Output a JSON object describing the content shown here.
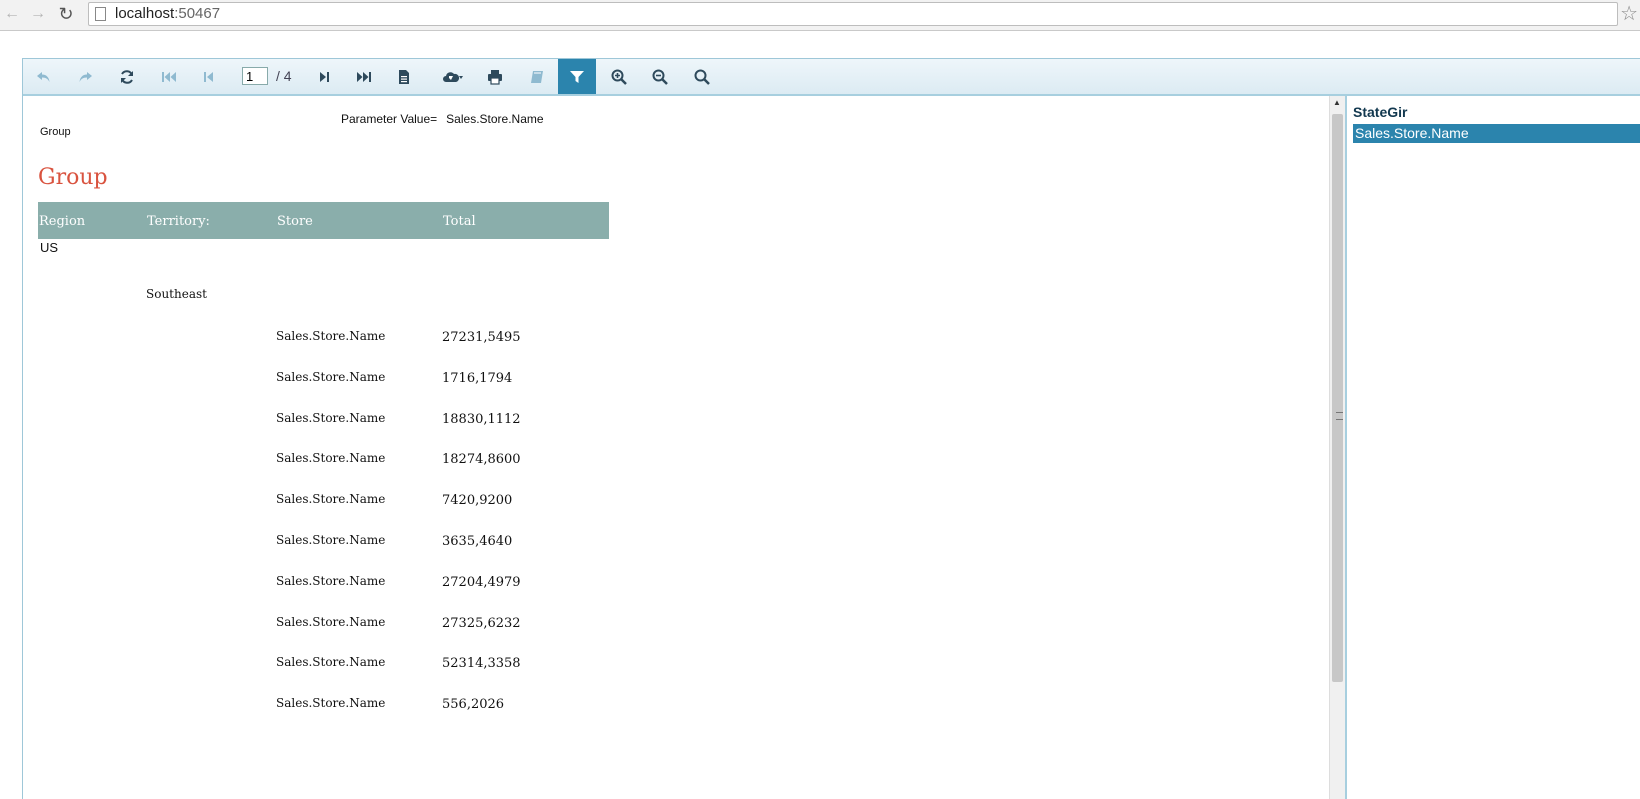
{
  "browser": {
    "url_host": "localhost",
    "url_port": ":50467"
  },
  "toolbar": {
    "current_page": "1",
    "total_pages": "/ 4"
  },
  "report": {
    "parameter_label": "Parameter Value=",
    "parameter_value": "Sales.Store.Name",
    "group_small_label": "Group",
    "group_title": "Group",
    "columns": [
      "Region",
      "Territory:",
      "Store",
      "Total"
    ],
    "region": "US",
    "territory": "Southeast",
    "rows": [
      {
        "store": "Sales.Store.Name",
        "total": "27231,5495"
      },
      {
        "store": "Sales.Store.Name",
        "total": "1716,1794"
      },
      {
        "store": "Sales.Store.Name",
        "total": "18830,1112"
      },
      {
        "store": "Sales.Store.Name",
        "total": "18274,8600"
      },
      {
        "store": "Sales.Store.Name",
        "total": "7420,9200"
      },
      {
        "store": "Sales.Store.Name",
        "total": "3635,4640"
      },
      {
        "store": "Sales.Store.Name",
        "total": "27204,4979"
      },
      {
        "store": "Sales.Store.Name",
        "total": "27325,6232"
      },
      {
        "store": "Sales.Store.Name",
        "total": "52314,3358"
      },
      {
        "store": "Sales.Store.Name",
        "total": "556,2026"
      }
    ]
  },
  "parameters_panel": {
    "label": "StateGir",
    "selected_value": "Sales.Store.Name"
  },
  "colors": {
    "toolbar_active": "#2b84ad",
    "header_bg": "#8aaeab",
    "group_title": "#d9533f",
    "panel_selected": "#2b84ad"
  }
}
